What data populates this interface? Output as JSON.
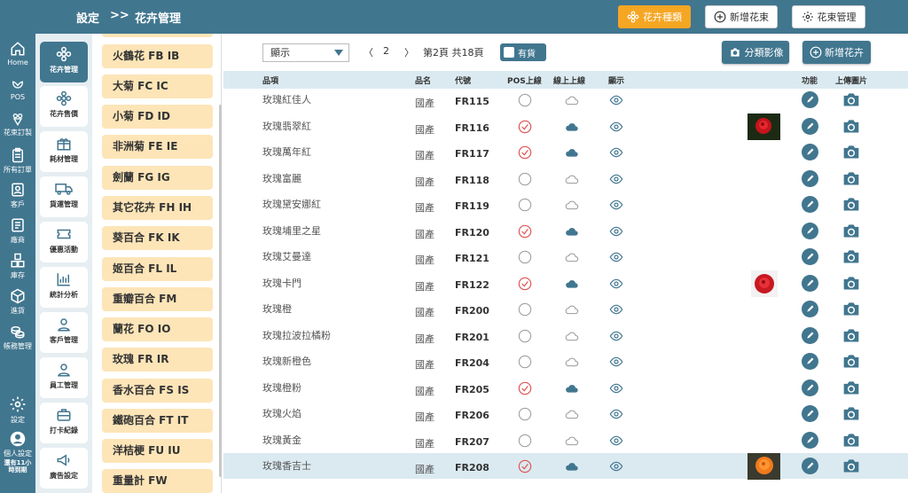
{
  "header": {
    "crumb_root": "設定",
    "crumb_sep": ">>",
    "crumb_current": "花卉管理",
    "btn_flower_types": "花卉種類",
    "btn_add_bouquet": "新增花束",
    "btn_bouquet_manage": "花束管理"
  },
  "rail": [
    {
      "label": "Home",
      "icon": "home-icon"
    },
    {
      "label": "POS",
      "icon": "flower-icon"
    },
    {
      "label": "花束訂製",
      "icon": "bouquet-icon"
    },
    {
      "label": "所有訂單",
      "icon": "clipboard-icon"
    },
    {
      "label": "客戶",
      "icon": "contact-icon"
    },
    {
      "label": "廠商",
      "icon": "vendor-icon"
    },
    {
      "label": "庫存",
      "icon": "boxes-icon"
    },
    {
      "label": "進貨",
      "icon": "box-icon"
    },
    {
      "label": "帳務管理",
      "icon": "coins-icon"
    },
    {
      "label": "設定",
      "icon": "gear-icon"
    },
    {
      "label": "個人設定",
      "icon": "user-icon"
    },
    {
      "label": "還有11小時到期",
      "icon": ""
    }
  ],
  "menu": [
    {
      "label": "花卉管理",
      "icon": "flower-gear-icon"
    },
    {
      "label": "花卉售價",
      "icon": "flower-price-icon"
    },
    {
      "label": "耗材管理",
      "icon": "gift-icon"
    },
    {
      "label": "貨運管理",
      "icon": "truck-icon"
    },
    {
      "label": "優惠活動",
      "icon": "ticket-icon"
    },
    {
      "label": "統計分析",
      "icon": "chart-icon"
    },
    {
      "label": "客戶管理",
      "icon": "person-icon"
    },
    {
      "label": "員工管理",
      "icon": "staff-icon"
    },
    {
      "label": "打卡紀錄",
      "icon": "briefcase-icon"
    },
    {
      "label": "廣告設定",
      "icon": "megaphone-icon"
    }
  ],
  "categories": [
    "火鶴花 FB IB",
    "大菊 FC IC",
    "小菊 FD ID",
    "非洲菊 FE IE",
    "劍蘭 FG IG",
    "其它花卉 FH IH",
    "葵百合 FK IK",
    "姬百合 FL IL",
    "重瓣百合 FM",
    "蘭花 FO IO",
    "玫瑰 FR IR",
    "香水百合 FS IS",
    "鐵砲百合 FT IT",
    "洋桔梗 FU IU",
    "重量計 FW"
  ],
  "toolbar": {
    "select_value": "顯示",
    "page_num": "2",
    "page_info": "第2頁 共18頁",
    "stock_label": "有貨",
    "btn_category_image": "分類影像",
    "btn_add_flower": "新增花卉"
  },
  "table": {
    "headers": {
      "name": "品項",
      "origin": "品名",
      "code": "代號",
      "pos": "POS上線",
      "online": "線上上線",
      "display": "顯示",
      "func": "功能",
      "upload": "上傳圖片"
    },
    "rows": [
      {
        "name": "玫瑰紅佳人",
        "origin": "國產",
        "code": "FR115",
        "pos": false,
        "online": false,
        "thumb": ""
      },
      {
        "name": "玫瑰翡翠紅",
        "origin": "國產",
        "code": "FR116",
        "pos": true,
        "online": true,
        "thumb": "rose-red"
      },
      {
        "name": "玫瑰萬年紅",
        "origin": "國產",
        "code": "FR117",
        "pos": true,
        "online": true,
        "thumb": ""
      },
      {
        "name": "玫瑰富麗",
        "origin": "國產",
        "code": "FR118",
        "pos": false,
        "online": false,
        "thumb": ""
      },
      {
        "name": "玫瑰黛安娜紅",
        "origin": "國產",
        "code": "FR119",
        "pos": false,
        "online": false,
        "thumb": ""
      },
      {
        "name": "玫瑰埔里之星",
        "origin": "國產",
        "code": "FR120",
        "pos": true,
        "online": true,
        "thumb": ""
      },
      {
        "name": "玫瑰艾曼達",
        "origin": "國產",
        "code": "FR121",
        "pos": false,
        "online": false,
        "thumb": ""
      },
      {
        "name": "玫瑰卡門",
        "origin": "國產",
        "code": "FR122",
        "pos": true,
        "online": true,
        "thumb": "rose-red-small"
      },
      {
        "name": "玫瑰橙",
        "origin": "國產",
        "code": "FR200",
        "pos": false,
        "online": false,
        "thumb": ""
      },
      {
        "name": "玫瑰拉波拉橘粉",
        "origin": "國產",
        "code": "FR201",
        "pos": false,
        "online": false,
        "thumb": ""
      },
      {
        "name": "玫瑰新橙色",
        "origin": "國產",
        "code": "FR204",
        "pos": false,
        "online": false,
        "thumb": ""
      },
      {
        "name": "玫瑰橙粉",
        "origin": "國產",
        "code": "FR205",
        "pos": true,
        "online": true,
        "thumb": ""
      },
      {
        "name": "玫瑰火焰",
        "origin": "國產",
        "code": "FR206",
        "pos": false,
        "online": false,
        "thumb": ""
      },
      {
        "name": "玫瑰黃金",
        "origin": "國產",
        "code": "FR207",
        "pos": false,
        "online": false,
        "thumb": ""
      },
      {
        "name": "玫瑰香吉士",
        "origin": "國產",
        "code": "FR208",
        "pos": true,
        "online": true,
        "thumb": "rose-orange"
      }
    ]
  },
  "colors": {
    "primary": "#41768f",
    "accent": "#f5a623",
    "category_bg": "#fde5b8",
    "check_red": "#e05555",
    "highlight": "#dbeaf1"
  }
}
